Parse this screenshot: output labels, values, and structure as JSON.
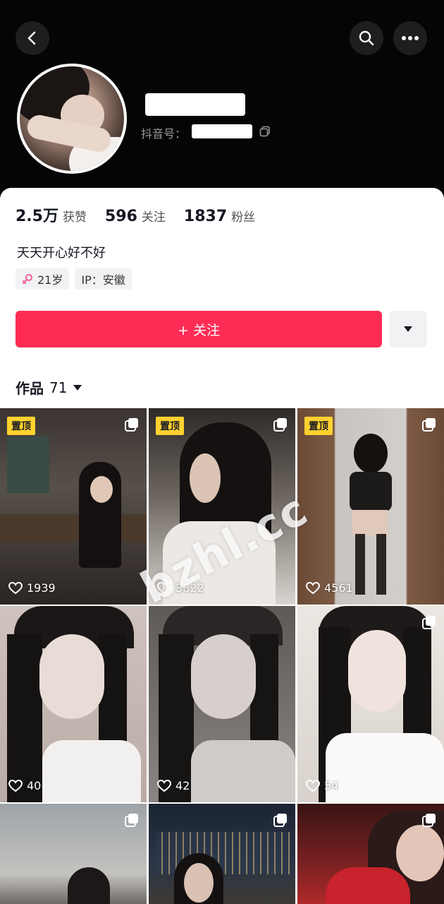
{
  "header": {
    "id_label": "抖音号：",
    "icons": [
      "back-icon",
      "search-icon",
      "more-icon",
      "copy-icon"
    ]
  },
  "stats": [
    {
      "value": "2.5万",
      "label": "获赞"
    },
    {
      "value": "596",
      "label": "关注"
    },
    {
      "value": "1837",
      "label": "粉丝"
    }
  ],
  "bio": "天天开心好不好",
  "tags": {
    "age": "21岁",
    "ip": "IP：安徽"
  },
  "follow_label": "+ 关注",
  "works_tab": {
    "label": "作品",
    "count": "71"
  },
  "pinned_label": "置顶",
  "watermark": "bzhl.cc",
  "posts": [
    {
      "likes": "1939",
      "pinned": true
    },
    {
      "likes": "3822",
      "pinned": true
    },
    {
      "likes": "4561",
      "pinned": true
    },
    {
      "likes": "40",
      "pinned": false
    },
    {
      "likes": "42",
      "pinned": false
    },
    {
      "likes": "54",
      "pinned": false
    }
  ],
  "colors": {
    "accent": "#fe2c55",
    "pin": "#ffd22f",
    "header_bg": "#050505"
  }
}
